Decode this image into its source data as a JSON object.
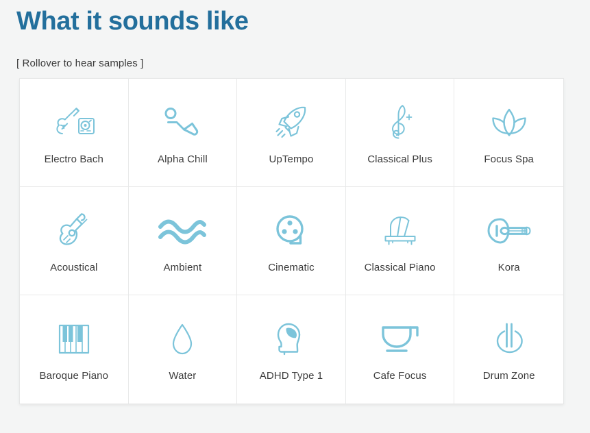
{
  "header": {
    "title": "What it sounds like",
    "subtitle": "[ Rollover to hear samples ]"
  },
  "colors": {
    "title_blue": "#236f9c",
    "icon_accent": "#7cc4da",
    "label_text": "#3c3c3c",
    "page_background": "#f4f5f5",
    "cell_background": "#ffffff",
    "grid_border": "#e8e9e9"
  },
  "grid": {
    "columns": 5,
    "rows": 3,
    "cells": [
      {
        "label": "Electro Bach",
        "icon": "violin-turntable-icon"
      },
      {
        "label": "Alpha Chill",
        "icon": "reclining-person-icon"
      },
      {
        "label": "UpTempo",
        "icon": "rocket-icon"
      },
      {
        "label": "Classical Plus",
        "icon": "treble-clef-plus-icon"
      },
      {
        "label": "Focus Spa",
        "icon": "lotus-flower-icon"
      },
      {
        "label": "Acoustical",
        "icon": "acoustic-guitar-icon"
      },
      {
        "label": "Ambient",
        "icon": "wavy-lines-icon"
      },
      {
        "label": "Cinematic",
        "icon": "film-reel-icon"
      },
      {
        "label": "Classical Piano",
        "icon": "grand-piano-icon"
      },
      {
        "label": "Kora",
        "icon": "lute-icon"
      },
      {
        "label": "Baroque Piano",
        "icon": "piano-keys-icon"
      },
      {
        "label": "Water",
        "icon": "water-droplet-icon"
      },
      {
        "label": "ADHD Type 1",
        "icon": "head-brain-icon"
      },
      {
        "label": "Cafe Focus",
        "icon": "coffee-cup-icon"
      },
      {
        "label": "Drum Zone",
        "icon": "drum-icon"
      }
    ]
  }
}
